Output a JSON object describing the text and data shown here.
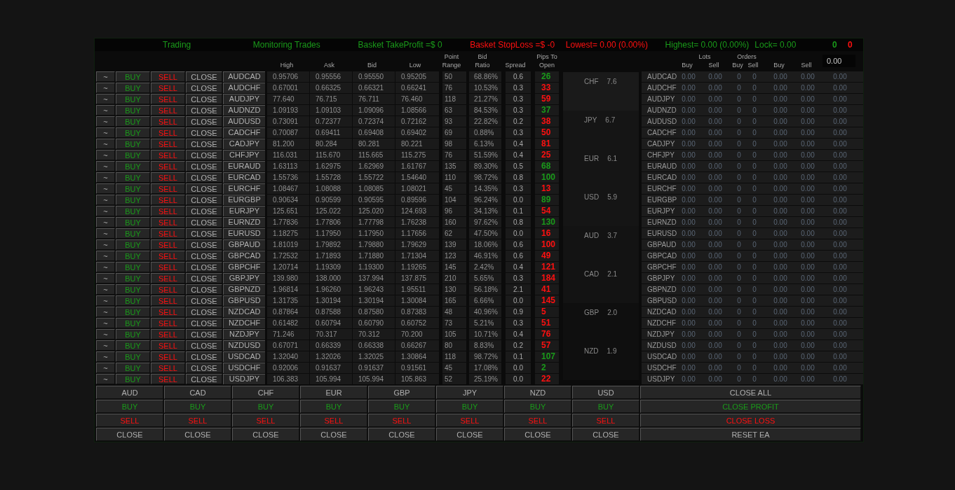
{
  "status_bar": [
    {
      "text": "Trading",
      "color": "#1a9a1a"
    },
    {
      "text": "Monitoring Trades",
      "color": "#1a9a1a"
    },
    {
      "text": "Basket TakeProfit =$ 0",
      "color": "#1a9a1a"
    },
    {
      "text": "Basket StopLoss =$ -0",
      "color": "#ff1010"
    },
    {
      "text": "Lowest= 0.00 (0.00%)",
      "color": "#ff1010"
    },
    {
      "text": "Highest= 0.00 (0.00%)",
      "color": "#1a9a1a"
    },
    {
      "text": "Lock= 0.00",
      "color": "#1a9a1a"
    },
    {
      "text": "0",
      "color": "#1a9a1a"
    },
    {
      "text": "0",
      "color": "#ff1010"
    }
  ],
  "columns": [
    "High",
    "Ask",
    "Bid",
    "Low",
    "Point Range",
    "Bid Ratio",
    "Spread",
    "Pips To Open"
  ],
  "pairs": [
    {
      "actions": [
        "~",
        "BUY",
        "SELL",
        "CLOSE"
      ],
      "pair": "AUDCAD",
      "high": "0.95706",
      "ask": "0.95556",
      "bid": "0.95550",
      "low": "0.95205",
      "range": "50",
      "ratio": "68.86%",
      "spread": "0.6",
      "pips": "26",
      "color": "#1a9a1a"
    },
    {
      "actions": [
        "~",
        "BUY",
        "SELL",
        "CLOSE"
      ],
      "pair": "AUDCHF",
      "high": "0.67001",
      "ask": "0.66325",
      "bid": "0.66321",
      "low": "0.66241",
      "range": "76",
      "ratio": "10.53%",
      "spread": "0.3",
      "pips": "33",
      "color": "#ff1010"
    },
    {
      "actions": [
        "~",
        "BUY",
        "SELL",
        "CLOSE"
      ],
      "pair": "AUDJPY",
      "high": "77.640",
      "ask": "76.715",
      "bid": "76.711",
      "low": "76.460",
      "range": "118",
      "ratio": "21.27%",
      "spread": "0.3",
      "pips": "59",
      "color": "#ff1010"
    },
    {
      "actions": [
        "~",
        "BUY",
        "SELL",
        "CLOSE"
      ],
      "pair": "AUDNZD",
      "high": "1.09193",
      "ask": "1.09103",
      "bid": "1.09096",
      "low": "1.08566",
      "range": "63",
      "ratio": "84.53%",
      "spread": "0.3",
      "pips": "37",
      "color": "#1a9a1a"
    },
    {
      "actions": [
        "~",
        "BUY",
        "SELL",
        "CLOSE"
      ],
      "pair": "AUDUSD",
      "high": "0.73091",
      "ask": "0.72377",
      "bid": "0.72374",
      "low": "0.72162",
      "range": "93",
      "ratio": "22.82%",
      "spread": "0.2",
      "pips": "38",
      "color": "#ff1010"
    },
    {
      "actions": [
        "~",
        "BUY",
        "SELL",
        "CLOSE"
      ],
      "pair": "CADCHF",
      "high": "0.70087",
      "ask": "0.69411",
      "bid": "0.69408",
      "low": "0.69402",
      "range": "69",
      "ratio": "0.88%",
      "spread": "0.3",
      "pips": "50",
      "color": "#ff1010"
    },
    {
      "actions": [
        "~",
        "BUY",
        "SELL",
        "CLOSE"
      ],
      "pair": "CADJPY",
      "high": "81.200",
      "ask": "80.284",
      "bid": "80.281",
      "low": "80.221",
      "range": "98",
      "ratio": "6.13%",
      "spread": "0.4",
      "pips": "81",
      "color": "#ff1010"
    },
    {
      "actions": [
        "~",
        "BUY",
        "SELL",
        "CLOSE"
      ],
      "pair": "CHFJPY",
      "high": "116.031",
      "ask": "115.670",
      "bid": "115.665",
      "low": "115.275",
      "range": "76",
      "ratio": "51.59%",
      "spread": "0.4",
      "pips": "25",
      "color": "#ff1010"
    },
    {
      "actions": [
        "~",
        "BUY",
        "SELL",
        "CLOSE"
      ],
      "pair": "EURAUD",
      "high": "1.63113",
      "ask": "1.62975",
      "bid": "1.62969",
      "low": "1.61767",
      "range": "135",
      "ratio": "89.30%",
      "spread": "0.5",
      "pips": "68",
      "color": "#1a9a1a"
    },
    {
      "actions": [
        "~",
        "BUY",
        "SELL",
        "CLOSE"
      ],
      "pair": "EURCAD",
      "high": "1.55736",
      "ask": "1.55728",
      "bid": "1.55722",
      "low": "1.54640",
      "range": "110",
      "ratio": "98.72%",
      "spread": "0.8",
      "pips": "100",
      "color": "#1a9a1a"
    },
    {
      "actions": [
        "~",
        "BUY",
        "SELL",
        "CLOSE"
      ],
      "pair": "EURCHF",
      "high": "1.08467",
      "ask": "1.08088",
      "bid": "1.08085",
      "low": "1.08021",
      "range": "45",
      "ratio": "14.35%",
      "spread": "0.3",
      "pips": "13",
      "color": "#ff1010"
    },
    {
      "actions": [
        "~",
        "BUY",
        "SELL",
        "CLOSE"
      ],
      "pair": "EURGBP",
      "high": "0.90634",
      "ask": "0.90599",
      "bid": "0.90595",
      "low": "0.89596",
      "range": "104",
      "ratio": "96.24%",
      "spread": "0.0",
      "pips": "89",
      "color": "#1a9a1a"
    },
    {
      "actions": [
        "~",
        "BUY",
        "SELL",
        "CLOSE"
      ],
      "pair": "EURJPY",
      "high": "125.651",
      "ask": "125.022",
      "bid": "125.020",
      "low": "124.693",
      "range": "96",
      "ratio": "34.13%",
      "spread": "0.1",
      "pips": "54",
      "color": "#ff1010"
    },
    {
      "actions": [
        "~",
        "BUY",
        "SELL",
        "CLOSE"
      ],
      "pair": "EURNZD",
      "high": "1.77836",
      "ask": "1.77806",
      "bid": "1.77798",
      "low": "1.76238",
      "range": "160",
      "ratio": "97.62%",
      "spread": "0.8",
      "pips": "130",
      "color": "#1a9a1a"
    },
    {
      "actions": [
        "~",
        "BUY",
        "SELL",
        "CLOSE"
      ],
      "pair": "EURUSD",
      "high": "1.18275",
      "ask": "1.17950",
      "bid": "1.17950",
      "low": "1.17656",
      "range": "62",
      "ratio": "47.50%",
      "spread": "0.0",
      "pips": "16",
      "color": "#ff1010"
    },
    {
      "actions": [
        "~",
        "BUY",
        "SELL",
        "CLOSE"
      ],
      "pair": "GBPAUD",
      "high": "1.81019",
      "ask": "1.79892",
      "bid": "1.79880",
      "low": "1.79629",
      "range": "139",
      "ratio": "18.06%",
      "spread": "0.6",
      "pips": "100",
      "color": "#ff1010"
    },
    {
      "actions": [
        "~",
        "BUY",
        "SELL",
        "CLOSE"
      ],
      "pair": "GBPCAD",
      "high": "1.72532",
      "ask": "1.71893",
      "bid": "1.71880",
      "low": "1.71304",
      "range": "123",
      "ratio": "46.91%",
      "spread": "0.6",
      "pips": "49",
      "color": "#ff1010"
    },
    {
      "actions": [
        "~",
        "BUY",
        "SELL",
        "CLOSE"
      ],
      "pair": "GBPCHF",
      "high": "1.20714",
      "ask": "1.19309",
      "bid": "1.19300",
      "low": "1.19265",
      "range": "145",
      "ratio": "2.42%",
      "spread": "0.4",
      "pips": "121",
      "color": "#ff1010"
    },
    {
      "actions": [
        "~",
        "BUY",
        "SELL",
        "CLOSE"
      ],
      "pair": "GBPJPY",
      "high": "139.980",
      "ask": "138.000",
      "bid": "137.994",
      "low": "137.875",
      "range": "210",
      "ratio": "5.65%",
      "spread": "0.3",
      "pips": "184",
      "color": "#ff1010"
    },
    {
      "actions": [
        "~",
        "BUY",
        "SELL",
        "CLOSE"
      ],
      "pair": "GBPNZD",
      "high": "1.96814",
      "ask": "1.96260",
      "bid": "1.96243",
      "low": "1.95511",
      "range": "130",
      "ratio": "56.18%",
      "spread": "2.1",
      "pips": "41",
      "color": "#ff1010"
    },
    {
      "actions": [
        "~",
        "BUY",
        "SELL",
        "CLOSE"
      ],
      "pair": "GBPUSD",
      "high": "1.31735",
      "ask": "1.30194",
      "bid": "1.30194",
      "low": "1.30084",
      "range": "165",
      "ratio": "6.66%",
      "spread": "0.0",
      "pips": "145",
      "color": "#ff1010"
    },
    {
      "actions": [
        "~",
        "BUY",
        "SELL",
        "CLOSE"
      ],
      "pair": "NZDCAD",
      "high": "0.87864",
      "ask": "0.87588",
      "bid": "0.87580",
      "low": "0.87383",
      "range": "48",
      "ratio": "40.96%",
      "spread": "0.9",
      "pips": "5",
      "color": "#ff1010"
    },
    {
      "actions": [
        "~",
        "BUY",
        "SELL",
        "CLOSE"
      ],
      "pair": "NZDCHF",
      "high": "0.61482",
      "ask": "0.60794",
      "bid": "0.60790",
      "low": "0.60752",
      "range": "73",
      "ratio": "5.21%",
      "spread": "0.3",
      "pips": "51",
      "color": "#ff1010"
    },
    {
      "actions": [
        "~",
        "BUY",
        "SELL",
        "CLOSE"
      ],
      "pair": "NZDJPY",
      "high": "71.246",
      "ask": "70.317",
      "bid": "70.312",
      "low": "70.200",
      "range": "105",
      "ratio": "10.71%",
      "spread": "0.4",
      "pips": "76",
      "color": "#ff1010"
    },
    {
      "actions": [
        "~",
        "BUY",
        "SELL",
        "CLOSE"
      ],
      "pair": "NZDUSD",
      "high": "0.67071",
      "ask": "0.66339",
      "bid": "0.66338",
      "low": "0.66267",
      "range": "80",
      "ratio": "8.83%",
      "spread": "0.2",
      "pips": "57",
      "color": "#ff1010"
    },
    {
      "actions": [
        "~",
        "BUY",
        "SELL",
        "CLOSE"
      ],
      "pair": "USDCAD",
      "high": "1.32040",
      "ask": "1.32026",
      "bid": "1.32025",
      "low": "1.30864",
      "range": "118",
      "ratio": "98.72%",
      "spread": "0.1",
      "pips": "107",
      "color": "#1a9a1a"
    },
    {
      "actions": [
        "~",
        "BUY",
        "SELL",
        "CLOSE"
      ],
      "pair": "USDCHF",
      "high": "0.92006",
      "ask": "0.91637",
      "bid": "0.91637",
      "low": "0.91561",
      "range": "45",
      "ratio": "17.08%",
      "spread": "0.0",
      "pips": "2",
      "color": "#1a9a1a"
    },
    {
      "actions": [
        "~",
        "BUY",
        "SELL",
        "CLOSE"
      ],
      "pair": "USDJPY",
      "high": "106.383",
      "ask": "105.994",
      "bid": "105.994",
      "low": "105.863",
      "range": "52",
      "ratio": "25.19%",
      "spread": "0.0",
      "pips": "22",
      "color": "#ff1010"
    }
  ],
  "strength": [
    {
      "currency": "CHF",
      "value": "7.6"
    },
    {
      "currency": "JPY",
      "value": "6.7"
    },
    {
      "currency": "EUR",
      "value": "6.1"
    },
    {
      "currency": "USD",
      "value": "5.9"
    },
    {
      "currency": "AUD",
      "value": "3.7"
    },
    {
      "currency": "CAD",
      "value": "2.1"
    },
    {
      "currency": "GBP",
      "value": "2.0"
    },
    {
      "currency": "NZD",
      "value": "1.9"
    }
  ],
  "positions": {
    "group_headers": [
      "Lots",
      "Orders"
    ],
    "columns": [
      "Buy",
      "Sell",
      "Buy",
      "Sell",
      "Buy",
      "Sell"
    ],
    "input": "0.00",
    "rows": [
      {
        "pair": "AUDCAD",
        "values": [
          "0.00",
          "0.00",
          "0",
          "0",
          "0.00",
          "0.00",
          "0.00"
        ]
      },
      {
        "pair": "AUDCHF",
        "values": [
          "0.00",
          "0.00",
          "0",
          "0",
          "0.00",
          "0.00",
          "0.00"
        ]
      },
      {
        "pair": "AUDJPY",
        "values": [
          "0.00",
          "0.00",
          "0",
          "0",
          "0.00",
          "0.00",
          "0.00"
        ]
      },
      {
        "pair": "AUDNZD",
        "values": [
          "0.00",
          "0.00",
          "0",
          "0",
          "0.00",
          "0.00",
          "0.00"
        ]
      },
      {
        "pair": "AUDUSD",
        "values": [
          "0.00",
          "0.00",
          "0",
          "0",
          "0.00",
          "0.00",
          "0.00"
        ]
      },
      {
        "pair": "CADCHF",
        "values": [
          "0.00",
          "0.00",
          "0",
          "0",
          "0.00",
          "0.00",
          "0.00"
        ]
      },
      {
        "pair": "CADJPY",
        "values": [
          "0.00",
          "0.00",
          "0",
          "0",
          "0.00",
          "0.00",
          "0.00"
        ]
      },
      {
        "pair": "CHFJPY",
        "values": [
          "0.00",
          "0.00",
          "0",
          "0",
          "0.00",
          "0.00",
          "0.00"
        ]
      },
      {
        "pair": "EURAUD",
        "values": [
          "0.00",
          "0.00",
          "0",
          "0",
          "0.00",
          "0.00",
          "0.00"
        ]
      },
      {
        "pair": "EURCAD",
        "values": [
          "0.00",
          "0.00",
          "0",
          "0",
          "0.00",
          "0.00",
          "0.00"
        ]
      },
      {
        "pair": "EURCHF",
        "values": [
          "0.00",
          "0.00",
          "0",
          "0",
          "0.00",
          "0.00",
          "0.00"
        ]
      },
      {
        "pair": "EURGBP",
        "values": [
          "0.00",
          "0.00",
          "0",
          "0",
          "0.00",
          "0.00",
          "0.00"
        ]
      },
      {
        "pair": "EURJPY",
        "values": [
          "0.00",
          "0.00",
          "0",
          "0",
          "0.00",
          "0.00",
          "0.00"
        ]
      },
      {
        "pair": "EURNZD",
        "values": [
          "0.00",
          "0.00",
          "0",
          "0",
          "0.00",
          "0.00",
          "0.00"
        ]
      },
      {
        "pair": "EURUSD",
        "values": [
          "0.00",
          "0.00",
          "0",
          "0",
          "0.00",
          "0.00",
          "0.00"
        ]
      },
      {
        "pair": "GBPAUD",
        "values": [
          "0.00",
          "0.00",
          "0",
          "0",
          "0.00",
          "0.00",
          "0.00"
        ]
      },
      {
        "pair": "GBPCAD",
        "values": [
          "0.00",
          "0.00",
          "0",
          "0",
          "0.00",
          "0.00",
          "0.00"
        ]
      },
      {
        "pair": "GBPCHF",
        "values": [
          "0.00",
          "0.00",
          "0",
          "0",
          "0.00",
          "0.00",
          "0.00"
        ]
      },
      {
        "pair": "GBPJPY",
        "values": [
          "0.00",
          "0.00",
          "0",
          "0",
          "0.00",
          "0.00",
          "0.00"
        ]
      },
      {
        "pair": "GBPNZD",
        "values": [
          "0.00",
          "0.00",
          "0",
          "0",
          "0.00",
          "0.00",
          "0.00"
        ]
      },
      {
        "pair": "GBPUSD",
        "values": [
          "0.00",
          "0.00",
          "0",
          "0",
          "0.00",
          "0.00",
          "0.00"
        ]
      },
      {
        "pair": "NZDCAD",
        "values": [
          "0.00",
          "0.00",
          "0",
          "0",
          "0.00",
          "0.00",
          "0.00"
        ]
      },
      {
        "pair": "NZDCHF",
        "values": [
          "0.00",
          "0.00",
          "0",
          "0",
          "0.00",
          "0.00",
          "0.00"
        ]
      },
      {
        "pair": "NZDJPY",
        "values": [
          "0.00",
          "0.00",
          "0",
          "0",
          "0.00",
          "0.00",
          "0.00"
        ]
      },
      {
        "pair": "NZDUSD",
        "values": [
          "0.00",
          "0.00",
          "0",
          "0",
          "0.00",
          "0.00",
          "0.00"
        ]
      },
      {
        "pair": "USDCAD",
        "values": [
          "0.00",
          "0.00",
          "0",
          "0",
          "0.00",
          "0.00",
          "0.00"
        ]
      },
      {
        "pair": "USDCHF",
        "values": [
          "0.00",
          "0.00",
          "0",
          "0",
          "0.00",
          "0.00",
          "0.00"
        ]
      },
      {
        "pair": "USDJPY",
        "values": [
          "0.00",
          "0.00",
          "0",
          "0",
          "0.00",
          "0.00",
          "0.00"
        ]
      }
    ]
  },
  "baskets": [
    {
      "currency": "AUD",
      "buttons": [
        "BUY",
        "SELL",
        "CLOSE"
      ]
    },
    {
      "currency": "CAD",
      "buttons": [
        "BUY",
        "SELL",
        "CLOSE"
      ]
    },
    {
      "currency": "CHF",
      "buttons": [
        "BUY",
        "SELL",
        "CLOSE"
      ]
    },
    {
      "currency": "EUR",
      "buttons": [
        "BUY",
        "SELL",
        "CLOSE"
      ]
    },
    {
      "currency": "GBP",
      "buttons": [
        "BUY",
        "SELL",
        "CLOSE"
      ]
    },
    {
      "currency": "JPY",
      "buttons": [
        "BUY",
        "SELL",
        "CLOSE"
      ]
    },
    {
      "currency": "NZD",
      "buttons": [
        "BUY",
        "SELL",
        "CLOSE"
      ]
    },
    {
      "currency": "USD",
      "buttons": [
        "BUY",
        "SELL",
        "CLOSE"
      ]
    }
  ],
  "global_buttons": [
    "CLOSE ALL",
    "CLOSE PROFIT",
    "CLOSE LOSS",
    "RESET EA"
  ]
}
